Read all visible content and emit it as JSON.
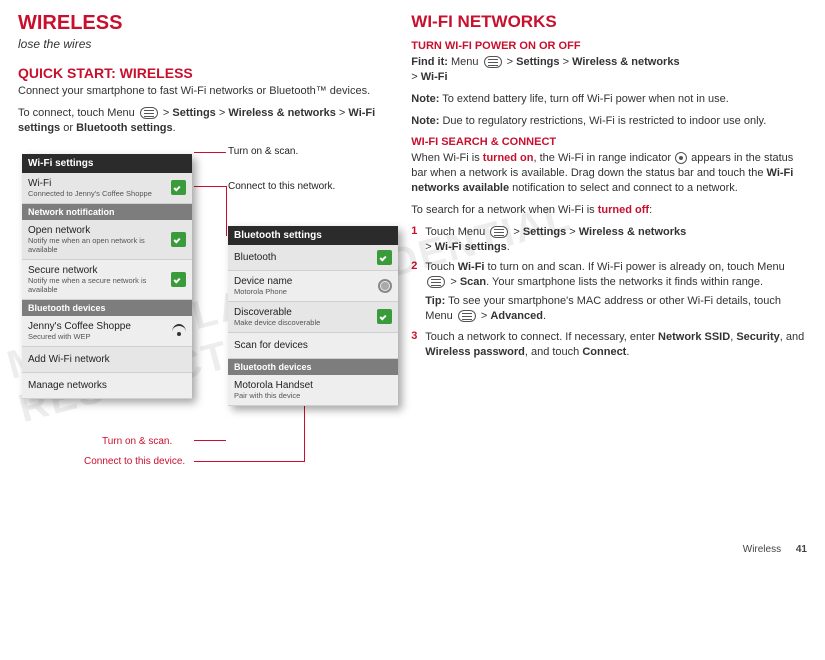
{
  "left": {
    "title": "WIRELESS",
    "subtitle": "lose the wires",
    "quickStartHeading": "QUICK START: WIRELESS",
    "p1": "Connect your smartphone to fast Wi-Fi networks or Bluetooth™ devices.",
    "p2a": "To connect, touch Menu ",
    "p2b": " > ",
    "settingsLbl": "Settings",
    "gt": " > ",
    "wnLbl": "Wireless & networks",
    "wifiSettingsLbl": "Wi-Fi settings",
    "orLbl": " or ",
    "btSettingsLbl": "Bluetooth settings",
    "period": "."
  },
  "callouts": {
    "turnScanTop": "Turn on & scan.",
    "connectNetwork": "Connect to this network.",
    "turnScanBottom": "Turn on & scan.",
    "connectDevice": "Connect to this device."
  },
  "wifiPhone": {
    "header": "Wi-Fi settings",
    "wifi": {
      "title": "Wi-Fi",
      "sub": "Connected to Jenny's Coffee Shoppe"
    },
    "sectionNotif": "Network notification",
    "open": {
      "title": "Open network",
      "sub": "Notify me when an open network is available"
    },
    "secure": {
      "title": "Secure network",
      "sub": "Notify me when a secure network is available"
    },
    "sectionDevices": "Bluetooth devices",
    "jenny": {
      "title": "Jenny's Coffee Shoppe",
      "sub": "Secured with WEP"
    },
    "add": "Add Wi-Fi network",
    "manage": "Manage networks"
  },
  "btPhone": {
    "header": "Bluetooth settings",
    "bt": "Bluetooth",
    "devname": {
      "title": "Device name",
      "sub": "Motorola Phone"
    },
    "disc": {
      "title": "Discoverable",
      "sub": "Make device discoverable"
    },
    "scan": "Scan for devices",
    "sectionDevices": "Bluetooth devices",
    "handset": {
      "title": "Motorola Handset",
      "sub": "Pair with this device"
    }
  },
  "right": {
    "title": "WI-FI NETWORKS",
    "sub1": "TURN WI-FI POWER ON OR OFF",
    "findIt": "Find it:",
    "findItPathA": " Menu ",
    "settingsLbl": "Settings",
    "gt": " > ",
    "wnLbl": "Wireless & networks",
    "wifiLbl": "Wi-Fi",
    "noteLbl": "Note:",
    "note1": " To extend battery life, turn off Wi-Fi power when not in use.",
    "note2": " Due to regulatory restrictions, Wi-Fi is restricted to indoor use only.",
    "sub2": "WI-FI SEARCH & CONNECT",
    "p3a": "When Wi-Fi is ",
    "turnedOn": "turned on",
    "p3b": ", the Wi-Fi in range indicator ",
    "p3c": " appears in the status bar when a network is available. Drag down the status bar and touch the ",
    "wifiAvailLbl": "Wi-Fi networks available",
    "p3d": " notification to select and connect to a network.",
    "p4a": "To search for a network when Wi-Fi is ",
    "turnedOff": "turned off",
    "p4b": ":",
    "step1a": "Touch Menu ",
    "step1b": " > ",
    "wifiSettingsLbl": "Wi-Fi settings",
    "step2a": "Touch ",
    "step2WiFi": "Wi-Fi",
    "step2b": " to turn on and scan. If Wi-Fi power is already on, touch Menu ",
    "scanLbl": "Scan",
    "step2c": ". Your smartphone lists the networks it finds within range.",
    "tipLbl": "Tip:",
    "tipBody": " To see your smartphone's MAC address or other Wi-Fi details, touch Menu ",
    "advancedLbl": "Advanced",
    "step3a": "Touch a network to connect. If necessary, enter ",
    "ssidLbl": "Network SSID",
    "comma": ", ",
    "securityLbl": "Security",
    "andLbl": ", and ",
    "wpwdLbl": "Wireless password",
    "andTouchLbl": ", and touch ",
    "connectLbl": "Connect"
  },
  "footer": {
    "section": "Wireless",
    "page": "41"
  }
}
